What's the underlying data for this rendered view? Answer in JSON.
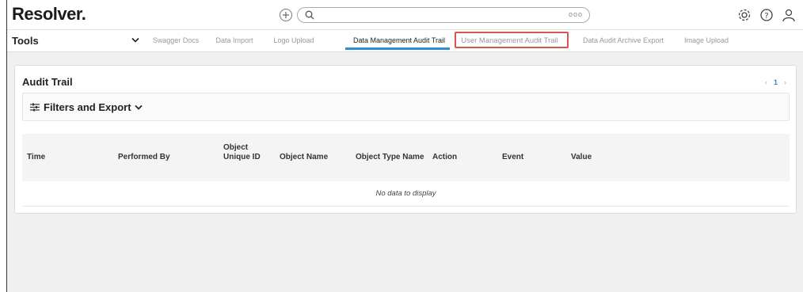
{
  "header": {
    "logo": "Resolver.",
    "search_placeholder": "",
    "more_label": "ooo",
    "icons": [
      "add-icon",
      "search-icon",
      "settings-gear-icon",
      "help-icon",
      "user-icon"
    ]
  },
  "toolsbar": {
    "label": "Tools",
    "tabs": [
      {
        "label": "Swagger Docs"
      },
      {
        "label": "Data Import"
      },
      {
        "label": "Logo Upload"
      },
      {
        "label": "Data Management Audit Trail",
        "active": true
      },
      {
        "label": "User Management Audit Trail",
        "highlighted": true
      },
      {
        "label": "Data Audit Archive Export"
      },
      {
        "label": "Image Upload"
      }
    ]
  },
  "card": {
    "title": "Audit Trail",
    "pager": {
      "prev": "‹",
      "current": "1",
      "next": "›"
    },
    "filters_label": "Filters and Export",
    "columns": [
      {
        "label": "Time"
      },
      {
        "label": "Performed By"
      },
      {
        "label": "Object Unique ID"
      },
      {
        "label": "Object Name"
      },
      {
        "label": "Object Type Name"
      },
      {
        "label": "Action"
      },
      {
        "label": "Event"
      },
      {
        "label": "Value"
      }
    ],
    "empty_message": "No data to display"
  },
  "colors": {
    "accent": "#2b8ed3",
    "highlight_border": "#d9534f",
    "page_bg": "#f0f0f0"
  }
}
